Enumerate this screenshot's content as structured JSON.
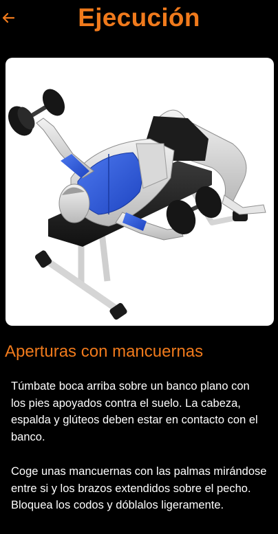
{
  "header": {
    "title": "Ejecución",
    "back_icon": "arrow-left-icon",
    "accent_color": "#f07a1c"
  },
  "illustration": {
    "icon": "dumbbell-flyes-illustration",
    "muscle_highlight_color": "#2f5fe0"
  },
  "exercise": {
    "name": "Aperturas con mancuernas",
    "instructions": [
      "Túmbate boca arriba sobre un banco plano con los pies apoyados contra el suelo. La cabeza, espalda y glúteos deben estar en contacto con el banco.",
      "Coge unas mancuernas con las palmas mirándose entre si y los brazos extendidos sobre el pecho. Bloquea los codos y dóblalos ligeramente."
    ]
  }
}
